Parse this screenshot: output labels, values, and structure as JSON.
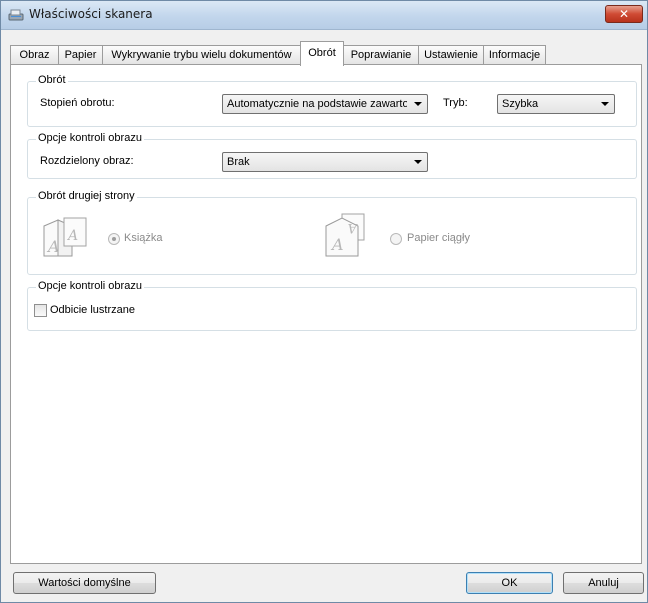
{
  "window": {
    "title": "Właściwości skanera",
    "close_label": "✕"
  },
  "tabs": [
    {
      "label": "Obraz"
    },
    {
      "label": "Papier"
    },
    {
      "label": "Wykrywanie trybu wielu dokumentów"
    },
    {
      "label": "Obrót"
    },
    {
      "label": "Poprawianie"
    },
    {
      "label": "Ustawienie"
    },
    {
      "label": "Informacje"
    }
  ],
  "active_tab": "Obrót",
  "rotation": {
    "title": "Obrót",
    "degree_label": "Stopień obrotu:",
    "degree_value": "Automatycznie na podstawie zawartości",
    "mode_label": "Tryb:",
    "mode_value": "Szybka"
  },
  "image_control": {
    "title": "Opcje kontroli obrazu",
    "split_label": "Rozdzielony obraz:",
    "split_value": "Brak"
  },
  "second_side": {
    "title": "Obrót drugiej strony",
    "book_label": "Książka",
    "fanfold_label": "Papier ciągły",
    "book_selected": true
  },
  "image_control2": {
    "title": "Opcje kontroli obrazu",
    "mirror_label": "Odbicie lustrzane",
    "mirror_checked": false
  },
  "buttons": {
    "defaults": "Wartości domyślne",
    "ok": "OK",
    "cancel": "Anuluj"
  }
}
